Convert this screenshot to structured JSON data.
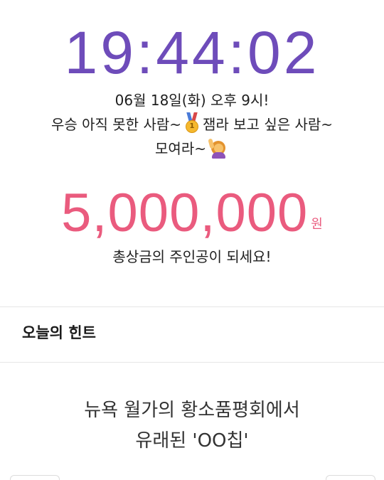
{
  "colors": {
    "clock": "#6e4cba",
    "prize": "#ea5b7e"
  },
  "clock": {
    "time": "19:44:02"
  },
  "announcement": {
    "line1": "06월 18일(화) 오후 9시!",
    "line2_a": "우승 아직 못한 사람~",
    "line2_b": "잼라 보고 싶은 사람~",
    "line3": "모여라~",
    "medal_emoji": "1st-place-medal-icon",
    "person_emoji": "person-raising-hand-icon",
    "medal_digit": "1"
  },
  "prize": {
    "amount": "5,000,000",
    "unit": "원",
    "caption": "총상금의 주인공이 되세요!"
  },
  "hint": {
    "header": "오늘의 힌트",
    "line1": "뉴욕 월가의 황소품평회에서",
    "line2": "유래된 'OO칩'"
  }
}
